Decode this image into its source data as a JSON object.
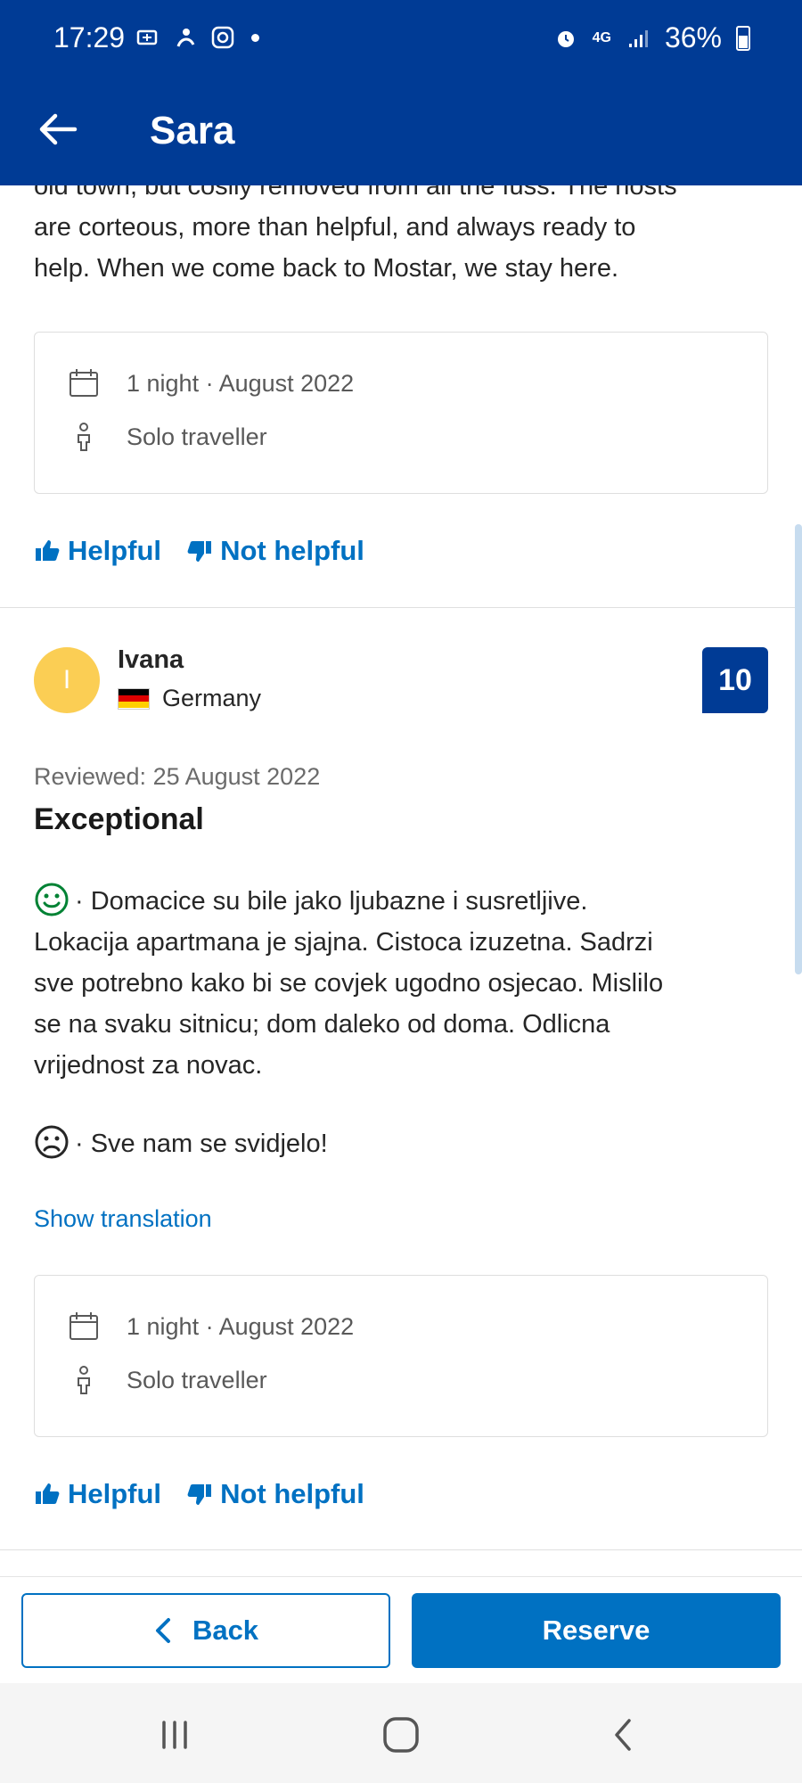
{
  "status_bar": {
    "time": "17:29",
    "battery": "36%",
    "network": "4G"
  },
  "header": {
    "title": "Sara",
    "back_icon": "arrow-left-icon"
  },
  "previous_review": {
    "text_lines": [
      "old town, but cosily removed from all the fuss. The hosts",
      "are corteous, more than helpful, and always ready to",
      "help. When we come back to Mostar, we stay here."
    ],
    "stay": {
      "nights": "1 night · August 2022",
      "traveller": "Solo traveller"
    },
    "helpful_label": "Helpful",
    "not_helpful_label": "Not helpful"
  },
  "review": {
    "avatar_initial": "I",
    "name": "Ivana",
    "country": "Germany",
    "score": "10",
    "reviewed_date": "Reviewed: 25 August 2022",
    "title": "Exceptional",
    "positive_lines": [
      "· Domacice su bile jako ljubazne i susretljive.",
      "Lokacija apartmana je sjajna. Cistoca izuzetna. Sadrzi",
      "sve potrebno kako bi se covjek ugodno osjecao. Mislilo",
      "se na svaku sitnicu; dom daleko od doma. Odlicna",
      "vrijednost za novac."
    ],
    "negative_text": "· Sve nam se svidjelo!",
    "show_translation": "Show translation",
    "stay": {
      "nights": "1 night · August 2022",
      "traveller": "Solo traveller"
    },
    "helpful_label": "Helpful",
    "not_helpful_label": "Not helpful"
  },
  "bottom_bar": {
    "back_label": "Back",
    "reserve_label": "Reserve"
  },
  "colors": {
    "header": "#003b95",
    "accent": "#0071c2",
    "avatar": "#fbce54",
    "positive": "#008234"
  }
}
